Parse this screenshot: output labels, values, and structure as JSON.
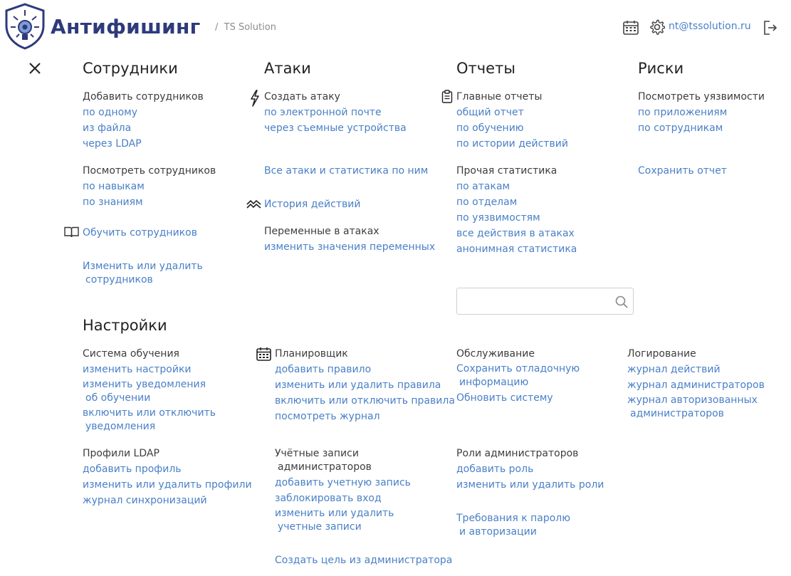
{
  "header": {
    "brand": "Антифишинг",
    "breadcrumb_sep": "/",
    "org": "TS Solution",
    "email": "nt@tssolution.ru",
    "icons": {
      "logo": "shield-eye-logo",
      "calendar": "calendar-icon",
      "settings": "gear-icon",
      "logout": "logout-icon"
    },
    "brand_color": "#2e3a7c",
    "link_color": "#4a80c7"
  },
  "close_icon": "close-icon",
  "employees": {
    "title": "Сотрудники",
    "add_label": "Добавить сотрудников",
    "add_links": [
      "по одному",
      "из файла",
      "через LDAP"
    ],
    "view_label": "Посмотреть сотрудников",
    "view_links": [
      "по навыкам",
      "по знаниям"
    ],
    "train": "Обучить сотрудников",
    "edit_line1": "Изменить или удалить",
    "edit_line2": "сотрудников"
  },
  "attacks": {
    "title": "Атаки",
    "create_label": "Создать атаку",
    "create_links": [
      "по электронной почте",
      "через съемные устройства"
    ],
    "all": "Все атаки и статистика по ним",
    "history": "История действий",
    "vars_label": "Переменные в атаках",
    "vars_link": "изменить значения переменных"
  },
  "reports": {
    "title": "Отчеты",
    "main_label": "Главные отчеты",
    "main_links": [
      "общий отчет",
      "по обучению",
      "по истории действий"
    ],
    "other_label": "Прочая статистика",
    "other_links": [
      "по атакам",
      "по отделам",
      "по уязвимостям",
      "все действия в атаках",
      "анонимная статистика"
    ]
  },
  "risks": {
    "title": "Риски",
    "view_label": "Посмотреть уязвимости",
    "view_links": [
      "по приложениям",
      "по сотрудникам"
    ],
    "save": "Сохранить отчет"
  },
  "search": {
    "placeholder": "",
    "icon": "search-icon"
  },
  "settings": {
    "title": "Настройки",
    "learning": {
      "label": "Система обучения",
      "l1": "изменить настройки",
      "l2a": "изменить уведомления",
      "l2b": "об обучении",
      "l3a": "включить или отключить",
      "l3b": "уведомления"
    },
    "ldap": {
      "label": "Профили LDAP",
      "links": [
        "добавить профиль",
        "изменить или удалить профили",
        "журнал синхронизаций"
      ]
    },
    "scheduler": {
      "label": "Планировщик",
      "links": [
        "добавить правило",
        "изменить или удалить правила",
        "включить или отключить правила",
        "посмотреть журнал"
      ]
    },
    "accounts": {
      "label1": "Учётные записи",
      "label2": "администраторов",
      "l1": "добавить учетную запись",
      "l2": "заблокировать вход",
      "l3a": "изменить или удалить",
      "l3b": "учетные записи",
      "target": "Создать цель из администратора"
    },
    "service": {
      "label": "Обслуживание",
      "l1a": "Сохранить отладочную",
      "l1b": "информацию",
      "l2": "Обновить систему"
    },
    "roles": {
      "label": "Роли администраторов",
      "links": [
        "добавить роль",
        "изменить или удалить роли"
      ],
      "req1": "Требования к паролю",
      "req2": "и авторизации"
    },
    "logging": {
      "label": "Логирование",
      "l1": "журнал действий",
      "l2": "журнал администраторов",
      "l3a": "журнал авторизованных",
      "l3b": "администраторов"
    }
  }
}
